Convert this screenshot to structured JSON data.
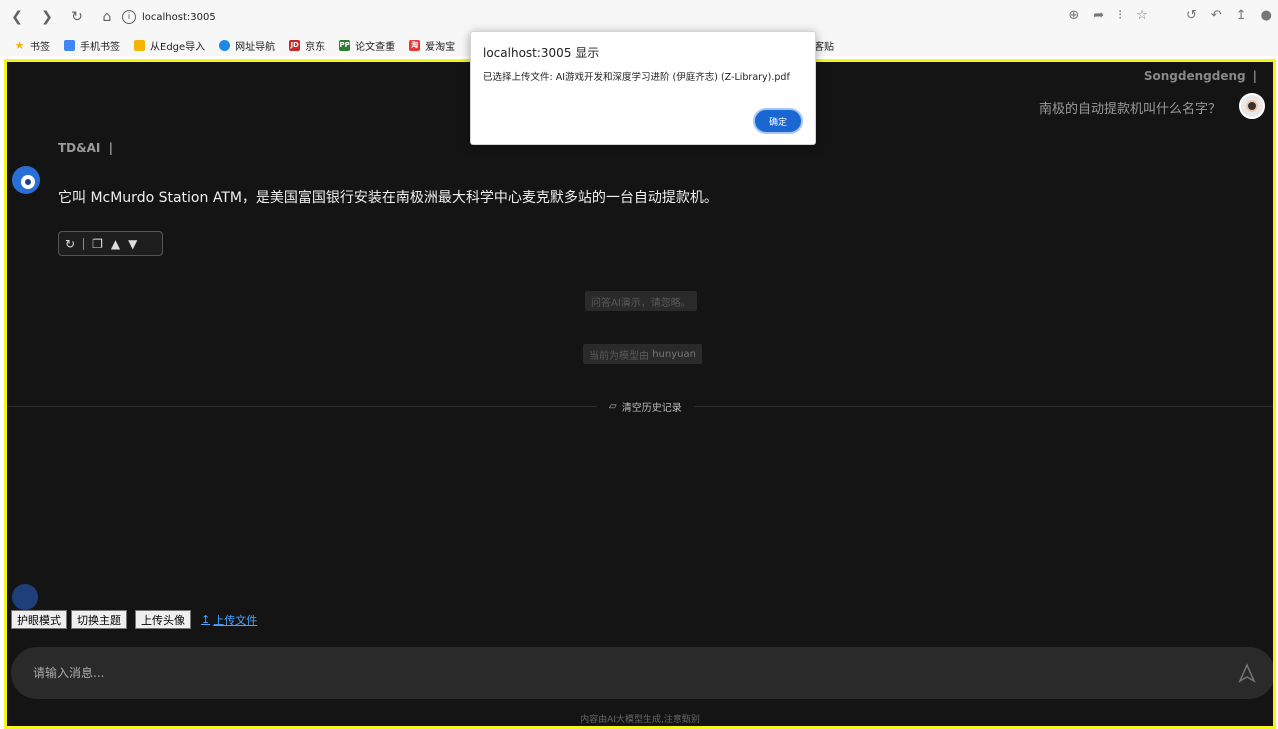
{
  "browser": {
    "url": "localhost:3005",
    "bookmarks": [
      {
        "label": "书签",
        "icon": "star-icon",
        "color": "#f4b400"
      },
      {
        "label": "手机书签",
        "icon": "mobile-bookmark-icon",
        "color": "#4285f4"
      },
      {
        "label": "从Edge导入",
        "icon": "folder-icon",
        "color": "#f4b400"
      },
      {
        "label": "网址导航",
        "icon": "nav-icon",
        "color": "#1e88e5"
      },
      {
        "label": "京东",
        "icon": "jd-icon",
        "color": "#c62828",
        "text": "JD"
      },
      {
        "label": "论文查重",
        "icon": "pp-icon",
        "color": "#2e7d32",
        "text": "PP"
      },
      {
        "label": "爱淘宝",
        "icon": "taobao-icon",
        "color": "#e53935",
        "text": "淘"
      }
    ],
    "bookmark_right": "客贴"
  },
  "chat": {
    "user_name": "Songdengdeng",
    "cursor": "|",
    "user_message": "南极的自动提款机叫什么名字？",
    "ai_name": "TD&AI",
    "ai_cursor": "|",
    "ai_message": "它叫 McMurdo Station ATM，是美国富国银行安装在南极洲最大科学中心麦克默多站的一台自动提款机。",
    "notice_1": "问答AI演示，请忽略。",
    "notice_2_prefix": "当前为模型由",
    "notice_2_model": "hunyuan",
    "clear_history": "清空历史记录"
  },
  "tools": {
    "eye_mode": "护眼模式",
    "switch_theme": "切换主题",
    "upload_avatar": "上传头像",
    "upload_file": "上传文件"
  },
  "input": {
    "placeholder": "请输入消息..."
  },
  "footer": "内容由AI大模型生成,注意甄别",
  "dialog": {
    "title": "localhost:3005 显示",
    "message": "已选择上传文件: AI游戏开发和深度学习进阶 (伊庭齐志) (Z-Library).pdf",
    "ok": "确定"
  },
  "colors": {
    "page_border": "#f5f51a",
    "page_bg": "#141414",
    "accent": "#1a67d2"
  }
}
